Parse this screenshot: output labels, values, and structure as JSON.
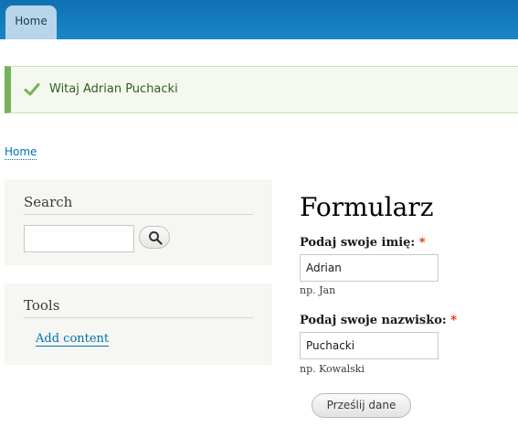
{
  "header": {
    "tab_label": "Home",
    "bar_color": "#1679bd"
  },
  "status": {
    "icon": "check-icon",
    "message": "Witaj Adrian Puchacki",
    "accent_color": "#77b259"
  },
  "breadcrumb": {
    "home_label": "Home"
  },
  "sidebar": {
    "search_block": {
      "title": "Search",
      "input_value": "",
      "button_icon": "search-icon"
    },
    "tools_block": {
      "title": "Tools",
      "links": [
        "Add content"
      ]
    }
  },
  "main": {
    "title": "Formularz",
    "fields": [
      {
        "label": "Podaj swoje imię:",
        "required_marker": "*",
        "value": "Adrian",
        "description": "np. Jan"
      },
      {
        "label": "Podaj swoje nazwisko:",
        "required_marker": "*",
        "value": "Puchacki",
        "description": "np. Kowalski"
      }
    ],
    "submit_label": "Prześlij dane"
  }
}
